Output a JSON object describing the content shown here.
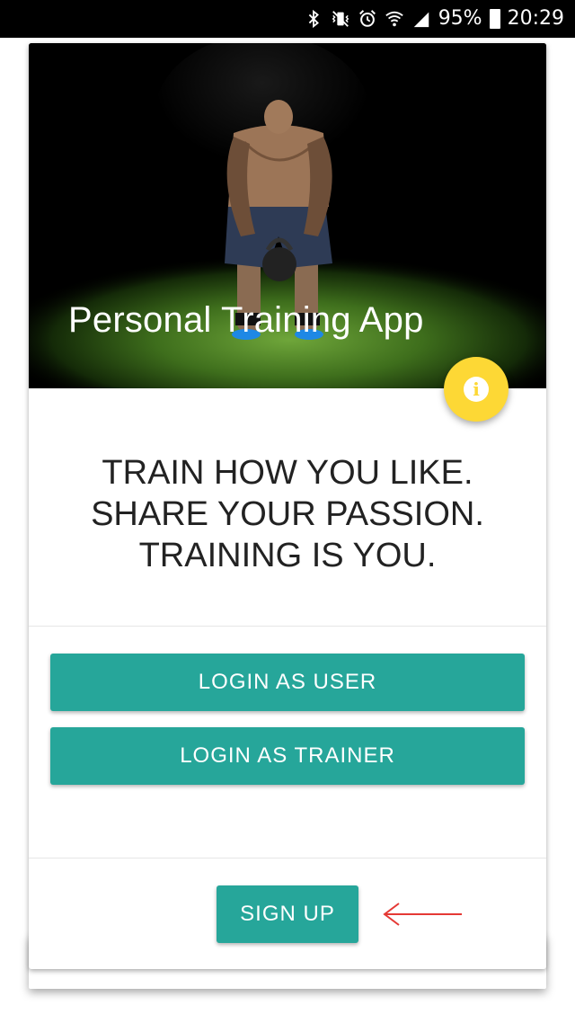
{
  "status_bar": {
    "battery_percent": "95%",
    "time": "20:29",
    "icons": [
      "bluetooth-icon",
      "vibrate-icon",
      "alarm-icon",
      "wifi-icon",
      "signal-icon",
      "battery-icon"
    ]
  },
  "hero": {
    "title": "Personal Training App"
  },
  "fab": {
    "icon": "info-icon",
    "glyph": "i",
    "color": "#fdd835"
  },
  "tagline": {
    "lines": [
      "TRAIN HOW YOU LIKE.",
      "SHARE YOUR PASSION.",
      "TRAINING IS YOU."
    ]
  },
  "buttons": {
    "login_user": "LOGIN AS USER",
    "login_trainer": "LOGIN AS TRAINER",
    "sign_up": "SIGN UP"
  },
  "colors": {
    "accent": "#26a69a",
    "fab": "#fdd835",
    "arrow": "#e53935"
  }
}
